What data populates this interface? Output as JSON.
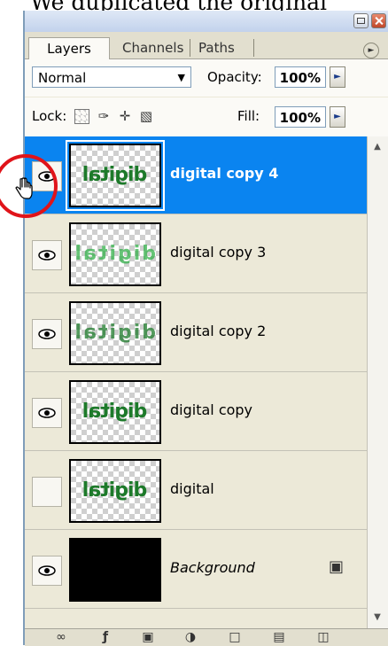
{
  "caption": "We duplicated the original",
  "window_buttons": {
    "minimize": "minimize",
    "close": "close"
  },
  "tabs": [
    {
      "label": "Layers",
      "active": true
    },
    {
      "label": "Channels",
      "active": false
    },
    {
      "label": "Paths",
      "active": false
    }
  ],
  "panel_menu_icon": "panel-menu-arrow",
  "blend_mode": "Normal",
  "opacity": {
    "label": "Opacity:",
    "value": "100%"
  },
  "lock": {
    "label": "Lock:",
    "icons": [
      "lock-transparent-pixels-icon",
      "lock-image-pixels-icon",
      "lock-position-icon",
      "lock-all-icon"
    ]
  },
  "fill": {
    "label": "Fill:",
    "value": "100%"
  },
  "layers": [
    {
      "name": "digital copy 4",
      "visible": true,
      "selected": true,
      "thumb": "digital"
    },
    {
      "name": "digital copy 3",
      "visible": true,
      "selected": false,
      "thumb": "digital"
    },
    {
      "name": "digital copy 2",
      "visible": true,
      "selected": false,
      "thumb": "digital"
    },
    {
      "name": "digital copy",
      "visible": true,
      "selected": false,
      "thumb": "digital"
    },
    {
      "name": "digital",
      "visible": false,
      "selected": false,
      "thumb": "digital"
    },
    {
      "name": "Background",
      "visible": true,
      "selected": false,
      "locked": true,
      "thumb": "black"
    }
  ],
  "footer_icons": [
    "link-layers-icon",
    "layer-style-icon",
    "layer-mask-icon",
    "adjustment-layer-icon",
    "new-group-icon",
    "new-layer-icon",
    "trash-icon"
  ],
  "colors": {
    "selection": "#0a84f0",
    "annotation_ring": "#e0141a",
    "text_green": "#1d7a2a"
  }
}
